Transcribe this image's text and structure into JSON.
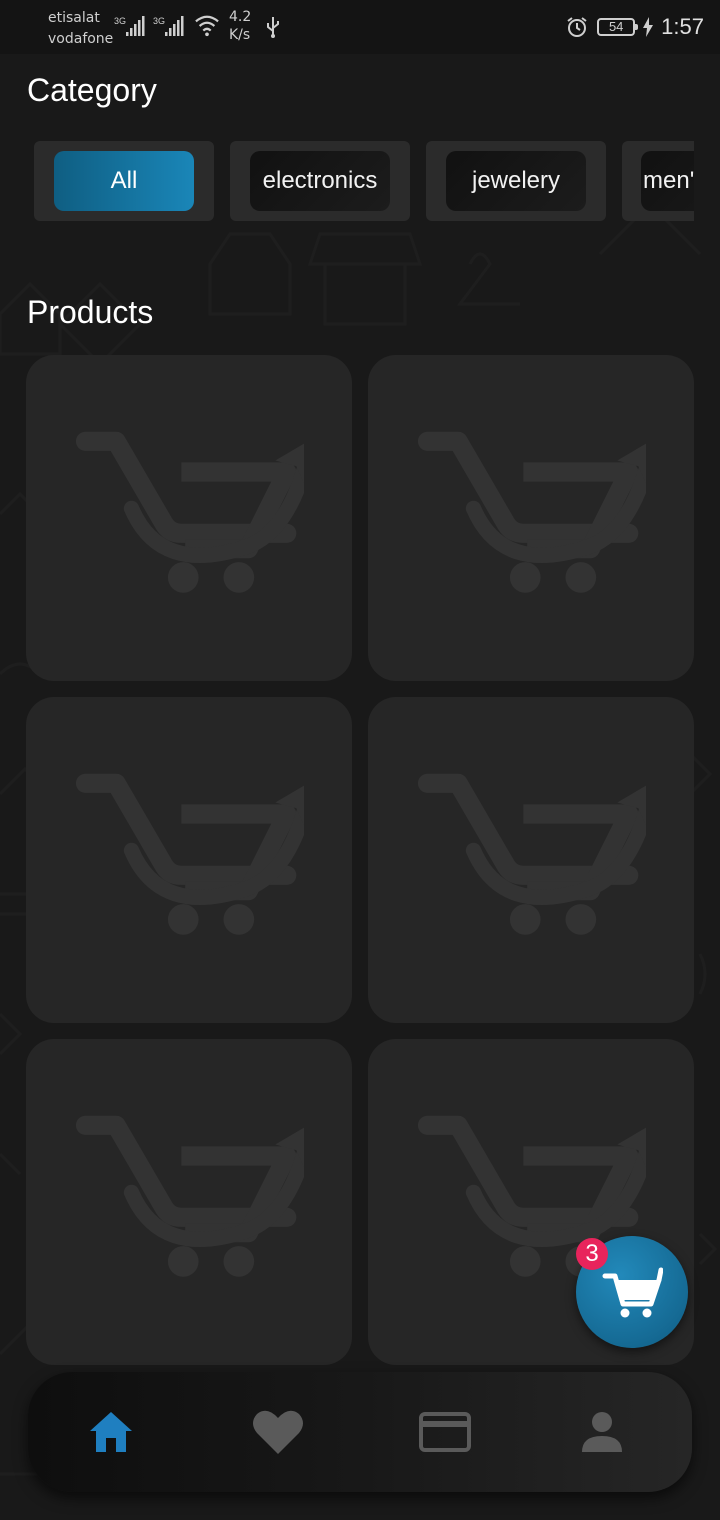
{
  "status_bar": {
    "carrier_1": "etisalat",
    "carrier_2": "vodafone",
    "network_1": "3G",
    "network_2": "3G",
    "speed_value": "4.2",
    "speed_unit": "K/s",
    "battery": "54",
    "time": "1:57",
    "icons": [
      "signal-bars-icon",
      "wifi-icon",
      "usb-icon",
      "alarm-icon",
      "battery-icon",
      "charging-bolt-icon"
    ]
  },
  "category_section": {
    "title": "Category",
    "chips": [
      {
        "label": "All",
        "selected": true
      },
      {
        "label": "electronics",
        "selected": false
      },
      {
        "label": "jewelery",
        "selected": false
      },
      {
        "label": "men'",
        "selected": false
      }
    ]
  },
  "products_section": {
    "title": "Products",
    "placeholder_icon": "cart-arrow-placeholder-icon",
    "product_count_visible": 6
  },
  "cart_fab": {
    "icon": "shopping-cart-icon",
    "badge_count": "3",
    "badge_color": "#e8245c",
    "color": "#1a7aa8"
  },
  "bottom_nav": {
    "items": [
      {
        "name": "home",
        "icon": "home-icon",
        "active": true
      },
      {
        "name": "favorites",
        "icon": "heart-icon",
        "active": false
      },
      {
        "name": "payments",
        "icon": "credit-card-icon",
        "active": false
      },
      {
        "name": "profile",
        "icon": "person-icon",
        "active": false
      }
    ],
    "active_color": "#1f7fc0",
    "inactive_color": "#5a5a5a"
  }
}
